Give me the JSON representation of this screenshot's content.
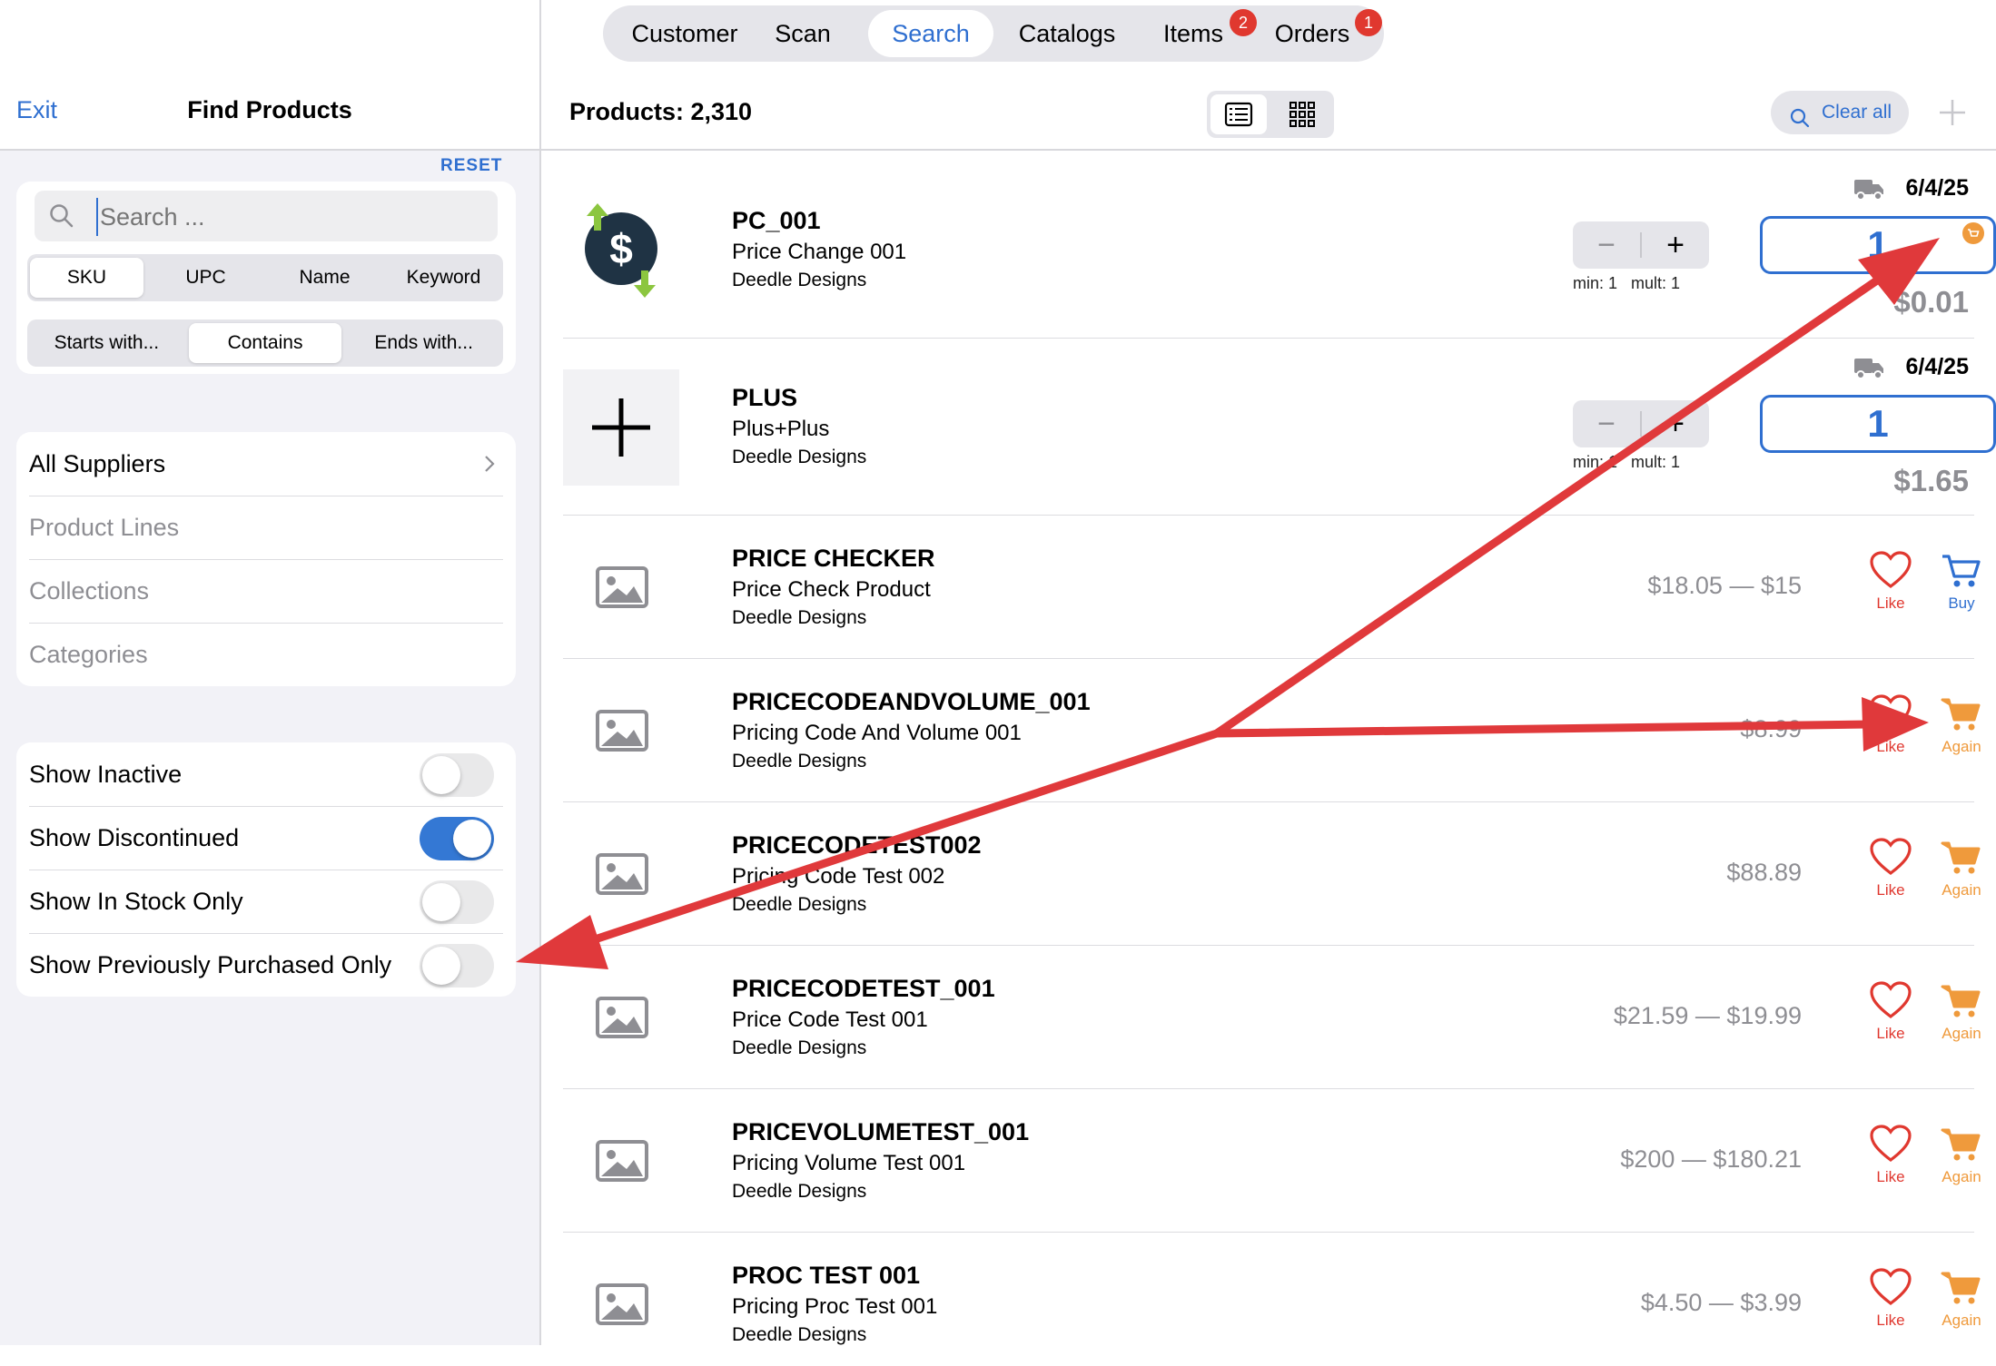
{
  "sidebar": {
    "exit_label": "Exit",
    "title": "Find Products",
    "reset_label": "RESET",
    "search": {
      "placeholder": "Search ..."
    },
    "search_fields": [
      {
        "label": "SKU",
        "selected": true
      },
      {
        "label": "UPC",
        "selected": false
      },
      {
        "label": "Name",
        "selected": false
      },
      {
        "label": "Keyword",
        "selected": false
      }
    ],
    "match_modes": [
      {
        "label": "Starts with...",
        "selected": false
      },
      {
        "label": "Contains",
        "selected": true
      },
      {
        "label": "Ends with...",
        "selected": false
      }
    ],
    "filters": [
      {
        "label": "All Suppliers",
        "enabled": true
      },
      {
        "label": "Product Lines",
        "enabled": false
      },
      {
        "label": "Collections",
        "enabled": false
      },
      {
        "label": "Categories",
        "enabled": false
      }
    ],
    "toggles": [
      {
        "label": "Show Inactive",
        "on": false
      },
      {
        "label": "Show Discontinued",
        "on": true
      },
      {
        "label": "Show In Stock Only",
        "on": false
      },
      {
        "label": "Show Previously Purchased Only",
        "on": false
      }
    ]
  },
  "tabs": [
    {
      "label": "Customer",
      "badge": ""
    },
    {
      "label": "Scan",
      "badge": ""
    },
    {
      "label": "Search",
      "badge": "",
      "selected": true
    },
    {
      "label": "Catalogs",
      "badge": ""
    },
    {
      "label": "Items",
      "badge": "2"
    },
    {
      "label": "Orders",
      "badge": "1"
    }
  ],
  "toolbar": {
    "products_count": "Products: 2,310",
    "clear_all_label": "Clear all"
  },
  "products": [
    {
      "sku": "PC_001",
      "name": "Price Change 001",
      "supplier": "Deedle Designs",
      "date": "6/4/25",
      "qty": "1",
      "min": "min: 1",
      "mult": "mult: 1",
      "price": "$0.01"
    },
    {
      "sku": "PLUS",
      "name": "Plus+Plus",
      "supplier": "Deedle Designs",
      "date": "6/4/25",
      "qty": "1",
      "min": "min: 1",
      "mult": "mult: 1",
      "price": "$1.65"
    },
    {
      "sku": "PRICE CHECKER",
      "name": "Price Check Product",
      "supplier": "Deedle Designs",
      "price_range": "$18.05 — $15",
      "like_label": "Like",
      "action_label": "Buy"
    },
    {
      "sku": "PRICECODEANDVOLUME_001",
      "name": "Pricing Code And Volume 001",
      "supplier": "Deedle Designs",
      "price_range": "$8.99",
      "like_label": "Like",
      "action_label": "Again"
    },
    {
      "sku": "PRICECODETEST002",
      "name": "Pricing Code Test 002",
      "supplier": "Deedle Designs",
      "price_range": "$88.89",
      "like_label": "Like",
      "action_label": "Again"
    },
    {
      "sku": "PRICECODETEST_001",
      "name": "Price Code Test 001",
      "supplier": "Deedle Designs",
      "price_range": "$21.59 — $19.99",
      "like_label": "Like",
      "action_label": "Again"
    },
    {
      "sku": "PRICEVOLUMETEST_001",
      "name": "Pricing Volume Test 001",
      "supplier": "Deedle Designs",
      "price_range": "$200 — $180.21",
      "like_label": "Like",
      "action_label": "Again"
    },
    {
      "sku": "PROC TEST 001",
      "name": "Pricing Proc Test 001",
      "supplier": "Deedle Designs",
      "price_range": "$4.50 — $3.99",
      "like_label": "Like",
      "action_label": "Again"
    }
  ],
  "colors": {
    "accent": "#2f6fd0",
    "like": "#e0382f",
    "again": "#ef9a3c",
    "annotation_arrow": "#e0393b"
  }
}
